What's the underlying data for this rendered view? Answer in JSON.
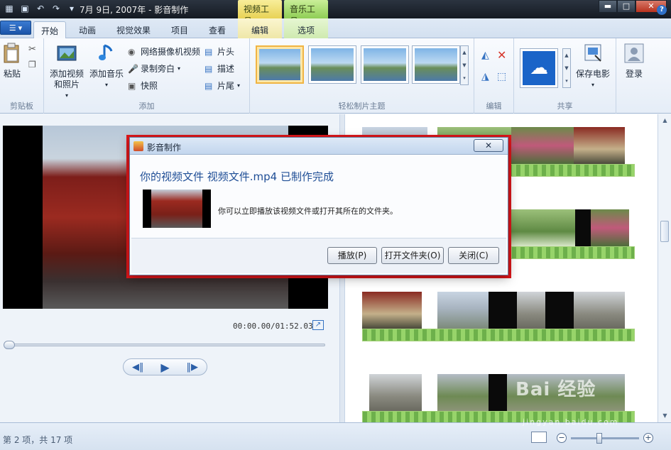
{
  "titlebar": {
    "title": "7月 9日, 2007年 - 影音制作",
    "context_tabs": {
      "video_tools": "视频工具",
      "music_tools": "音乐工具"
    }
  },
  "tabs": [
    {
      "label": "开始"
    },
    {
      "label": "动画"
    },
    {
      "label": "视觉效果"
    },
    {
      "label": "项目"
    },
    {
      "label": "查看"
    },
    {
      "label": "编辑"
    },
    {
      "label": "选项"
    }
  ],
  "ribbon": {
    "clipboard": {
      "paste": "粘贴",
      "group": "剪贴板"
    },
    "add": {
      "add_video_photo_line1": "添加视频",
      "add_video_photo_line2": "和照片",
      "add_music": "添加音乐",
      "webcam": "网络摄像机视频",
      "narration": "录制旁白",
      "snapshot": "快照",
      "title": "片头",
      "caption": "描述",
      "credits": "片尾",
      "group": "添加"
    },
    "themes": {
      "group": "轻松制片主题"
    },
    "editing": {
      "group": "编辑"
    },
    "share": {
      "save_movie": "保存电影",
      "group": "共享"
    },
    "signin": {
      "label": "登录"
    }
  },
  "preview": {
    "timecode": "00:00.00/01:52.03"
  },
  "dialog": {
    "title": "影音制作",
    "heading": "你的视频文件 视频文件.mp4 已制作完成",
    "body": "你可以立即播放该视频文件或打开其所在的文件夹。",
    "buttons": {
      "play": "播放(P)",
      "open_folder": "打开文件夹(O)",
      "close": "关闭(C)"
    }
  },
  "status": {
    "text": "第 2 项，共 17 项"
  },
  "watermark": {
    "brand": "Bai 经验",
    "url": "jingyan.baidu.com"
  },
  "colors": {
    "accent": "#1f4e96",
    "highlight_box": "#e0161a"
  }
}
